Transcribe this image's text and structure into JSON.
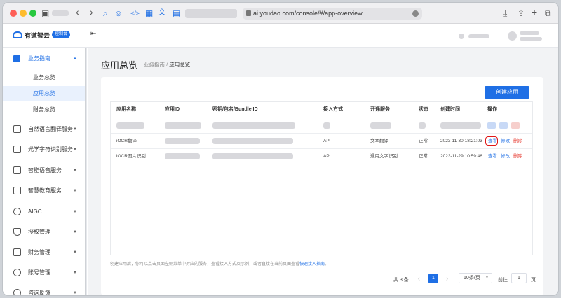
{
  "browser": {
    "url": "ai.youdao.com/console/#/app-overview"
  },
  "colors": {
    "accent": "#1f6fe5",
    "danger": "#e8453c",
    "highlight": "#e01818"
  },
  "header": {
    "brand": "有道智云",
    "console_badge": "控制台"
  },
  "sidebar": {
    "section": {
      "label": "业务指南",
      "children": [
        "业务总览",
        "应用总览",
        "财务总览"
      ]
    },
    "items": [
      "自然语言翻译服务",
      "光学字符识别服务",
      "智能语音服务",
      "智慧教育服务",
      "AIGC",
      "授权管理",
      "财务管理",
      "账号管理",
      "咨询反馈"
    ]
  },
  "page": {
    "title": "应用总览",
    "breadcrumb_parent": "业务指南",
    "breadcrumb_sep": "/",
    "breadcrumb_current": "应用总览"
  },
  "create_button": "创建应用",
  "table": {
    "headers": [
      "应用名称",
      "应用ID",
      "密钥/包名/Bundle ID",
      "接入方式",
      "开通服务",
      "状态",
      "创建时间",
      "操作"
    ],
    "rows": [
      {
        "name": "iOCR翻译",
        "access": "API",
        "service": "文本翻译",
        "status": "正常",
        "created": "2023-11-30 18:21:03",
        "view": "查看",
        "edit": "修改",
        "delete": "删除"
      },
      {
        "name": "iOCR图片识别",
        "access": "API",
        "service": "通用文字识别",
        "status": "正常",
        "created": "2023-11-29 10:59:46",
        "view": "查看",
        "edit": "修改",
        "delete": "删除"
      }
    ]
  },
  "footer": {
    "hint": "创建应用后，你可以点击页面左侧菜单中对应的服务，查看接入方式及示例，或者直接在当前页面查看",
    "hint_link": "快速接入指南",
    "hint_end": "。"
  },
  "pagination": {
    "total": "共 3 条",
    "current": "1",
    "page_size": "10条/页",
    "goto": "前往",
    "goto_value": "1",
    "page_unit": "页",
    "prev": "‹",
    "next": "›"
  }
}
